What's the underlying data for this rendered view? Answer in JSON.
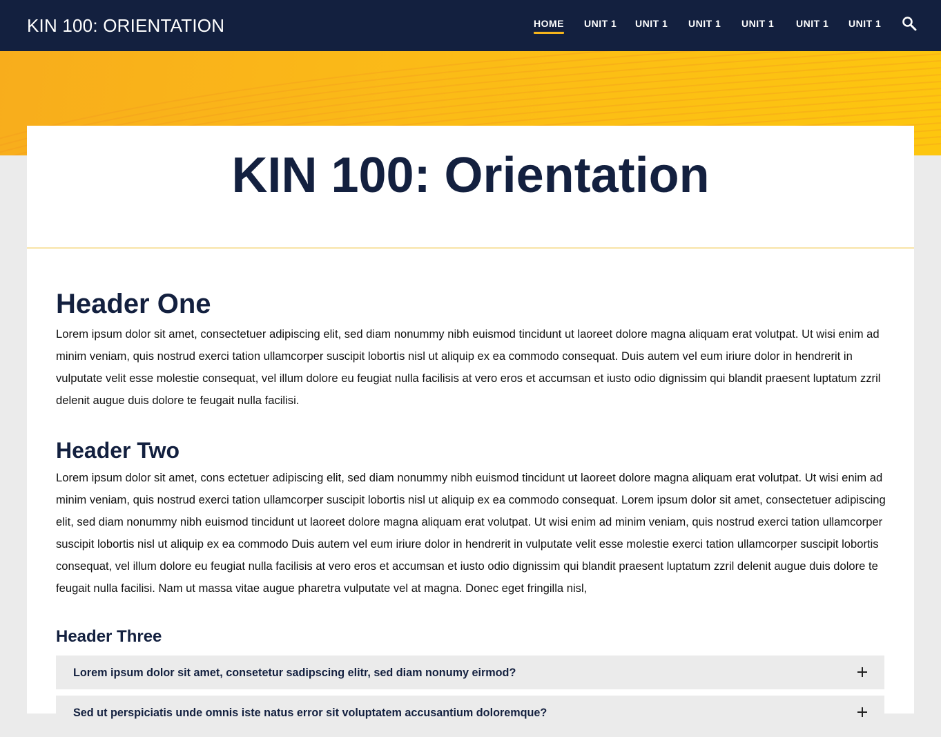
{
  "header": {
    "site_title": "KIN 100: ORIENTATION",
    "search_icon": "search-icon",
    "nav": [
      {
        "label": "HOME",
        "active": true
      },
      {
        "label": "UNIT 1",
        "active": false
      },
      {
        "label": "UNIT 1",
        "active": false
      },
      {
        "label": "UNIT 1",
        "active": false
      },
      {
        "label": "UNIT 1",
        "active": false
      },
      {
        "label": "UNIT 1",
        "active": false
      },
      {
        "label": "UNIT 1",
        "active": false
      }
    ]
  },
  "page": {
    "title": "KIN 100: Orientation",
    "sections": [
      {
        "heading": "Header One",
        "body": "Lorem ipsum dolor sit amet, consectetuer adipiscing elit, sed diam nonummy nibh euismod tincidunt ut laoreet dolore magna aliquam erat volutpat. Ut wisi enim ad minim veniam, quis nostrud exerci tation ullamcorper suscipit lobortis nisl ut aliquip ex ea commodo consequat. Duis autem vel eum iriure dolor in hendrerit in vulputate velit esse molestie consequat, vel illum dolore eu feugiat nulla facilisis at vero eros et accumsan et iusto odio dignissim qui blandit praesent luptatum zzril delenit augue duis dolore te feugait nulla facilisi."
      },
      {
        "heading": "Header Two",
        "body": "Lorem ipsum dolor sit amet, cons ectetuer adipiscing elit, sed diam nonummy nibh euismod tincidunt ut laoreet dolore magna aliquam erat volutpat. Ut wisi enim ad minim veniam, quis nostrud exerci tation ullamcorper suscipit lobortis nisl ut aliquip ex ea commodo consequat. Lorem ipsum dolor sit amet, consectetuer adipiscing elit, sed diam nonummy nibh euismod tincidunt ut laoreet dolore magna aliquam erat volutpat. Ut wisi enim ad minim veniam, quis nostrud exerci tation ullamcorper suscipit lobortis nisl ut aliquip ex ea commodo Duis autem vel eum iriure dolor in hendrerit in vulputate velit esse molestie exerci tation ullamcorper suscipit lobortis consequat, vel illum dolore eu feugiat nulla facilisis at vero eros et accumsan et iusto odio dignissim qui blandit praesent luptatum zzril delenit augue duis dolore te feugait nulla facilisi. Nam ut massa vitae augue pharetra vulputate vel at magna. Donec eget fringilla nisl,"
      },
      {
        "heading": "Header Three"
      }
    ],
    "accordion": [
      {
        "question": "Lorem ipsum dolor sit amet, consetetur sadipscing elitr, sed diam nonumy eirmod?",
        "expanded": false,
        "icon": "plus-icon"
      },
      {
        "question": "Sed ut perspiciatis unde omnis iste natus error sit voluptatem accusantium doloremque?",
        "expanded": false,
        "icon": "plus-icon"
      }
    ]
  },
  "colors": {
    "navy": "#13203f",
    "accent_yellow": "#f5b51c",
    "hero_yellow": "#fbbb17",
    "page_bg": "#ebebeb",
    "card_bg": "#ffffff",
    "accordion_bg": "#ebebeb"
  }
}
